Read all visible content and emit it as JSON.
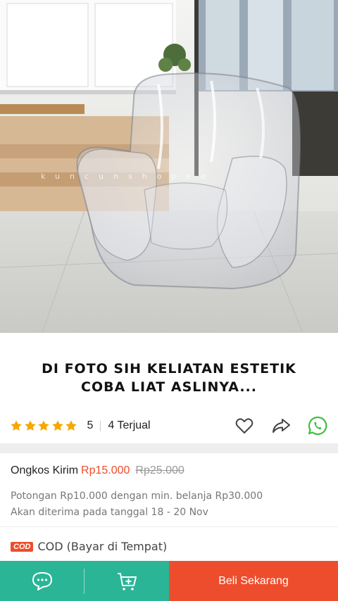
{
  "photo": {
    "alt": "Clear inflatable chair",
    "watermark": "kuncunshopee"
  },
  "caption": {
    "line1": "DI FOTO SIH KELIATAN ESTETIK",
    "line2": "COBA LIAT ASLINYA..."
  },
  "rating": {
    "stars": 5,
    "value": "5",
    "sold": "4 Terjual",
    "star_color": "#f6a700"
  },
  "actions": {
    "like_icon": "heart-icon",
    "share_icon": "share-icon",
    "whatsapp_icon": "whatsapp-icon",
    "whatsapp_color": "#3fbf3f"
  },
  "shipping": {
    "label": "Ongkos Kirim",
    "price": "Rp15.000",
    "old_price": "Rp25.000",
    "discount_note": "Potongan Rp10.000 dengan min. belanja Rp30.000",
    "delivery_note": "Akan diterima pada tanggal 18 - 20 Nov"
  },
  "cod": {
    "badge": "COD",
    "label": "COD (Bayar di Tempat)"
  },
  "bottom_bar": {
    "chat_icon": "chat-icon",
    "cart_icon": "add-to-cart-icon",
    "buy_label": "Beli Sekarang",
    "left_color": "#2ab596",
    "buy_color": "#ee4d2d"
  }
}
